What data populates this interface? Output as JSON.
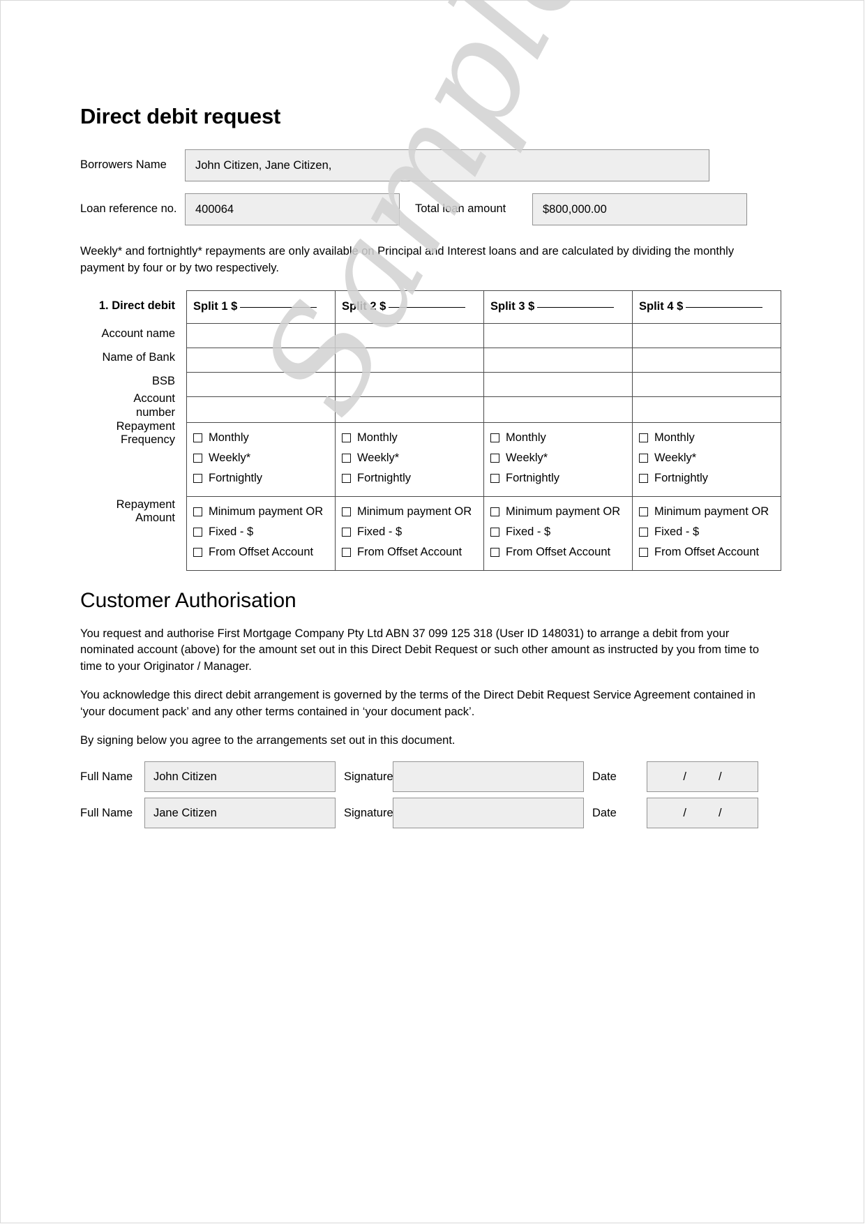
{
  "document": {
    "title": "Direct debit request",
    "watermark": "Sample"
  },
  "header_fields": {
    "borrowers_name_label": "Borrowers Name",
    "borrowers_name_value": "John Citizen, Jane Citizen,",
    "loan_reference_label": "Loan reference no.",
    "loan_reference_value": "400064",
    "total_loan_amount_label": "Total loan amount",
    "total_loan_amount_value": "$800,000.00"
  },
  "intro_note": "Weekly* and fortnightly* repayments are only available on Principal and Interest loans and are calculated by dividing the monthly payment by four or by two respectively.",
  "split_table": {
    "section_label": "1. Direct debit",
    "row_labels": {
      "account_name": "Account name",
      "name_of_bank": "Name of Bank",
      "bsb": "BSB",
      "account_number_line1": "Account",
      "account_number_line2": "number",
      "repayment_frequency_line1": "Repayment",
      "repayment_frequency_line2": "Frequency",
      "repayment_amount_line1": "Repayment",
      "repayment_amount_line2": "Amount"
    },
    "columns": [
      {
        "header": "Split 1 $"
      },
      {
        "header": "Split 2 $"
      },
      {
        "header": "Split 3 $"
      },
      {
        "header": "Split 4 $"
      }
    ],
    "frequency_options": [
      "Monthly",
      "Weekly*",
      "Fortnightly"
    ],
    "amount_options": [
      "Minimum payment OR",
      "Fixed - $",
      "From Offset Account"
    ]
  },
  "authorisation": {
    "heading": "Customer Authorisation",
    "paragraph_1": "You request and authorise First Mortgage Company Pty Ltd ABN 37 099 125 318 (User ID 148031) to arrange a debit from your nominated account (above) for the amount set out in this Direct Debit Request or such other amount as instructed by you from time to time to your Originator / Manager.",
    "paragraph_2": "You acknowledge this direct debit arrangement is governed by the terms of the Direct Debit Request Service Agreement contained in ‘your document pack’ and any other terms contained in ‘your document pack’.",
    "paragraph_3": "By signing below you agree to the arrangements set out in this document."
  },
  "signatures": {
    "full_name_label": "Full Name",
    "signature_label": "Signature",
    "date_label": "Date",
    "date_separator": "/",
    "rows": [
      {
        "full_name": "John Citizen",
        "signature": "",
        "date": ""
      },
      {
        "full_name": "Jane Citizen",
        "signature": "",
        "date": ""
      }
    ]
  },
  "colors": {
    "field_fill": "#eeeeee",
    "field_border": "#949494",
    "table_border": "#4a4a4a",
    "watermark": "#d2d2d2"
  }
}
